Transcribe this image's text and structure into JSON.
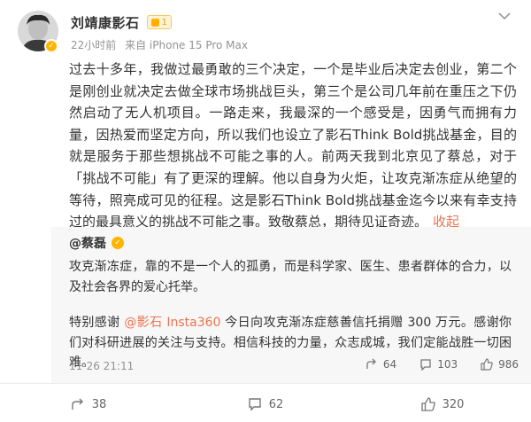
{
  "author": {
    "name": "刘靖康影石",
    "level_badge": "1"
  },
  "meta": {
    "time": "22小时前",
    "source": "来自 iPhone 15 Pro Max"
  },
  "content": {
    "text": "过去十多年，我做过最勇敢的三个决定，一个是毕业后决定去创业，第二个是刚创业就决定去做全球市场挑战巨头，第三个是公司几年前在重压之下仍然启动了无人机项目。一路走来，我最深的一个感受是，因勇气而拥有力量，因热爱而坚定方向，所以我们也设立了影石Think Bold挑战基金，目的就是服务于那些想挑战不可能之事的人。前两天我到北京见了蔡总，对于「挑战不可能」有了更深的理解。他以自身为火炬，让攻克渐冻症从绝望的等待，照亮成可见的征程。这是影石Think Bold挑战基金迄今以来有幸支持过的最具意义的挑战不可能之事。致敬蔡总，期待见证奇迹。",
    "collapse_label": "收起"
  },
  "repost": {
    "author": "@蔡磊",
    "paragraph1": "攻克渐冻症，靠的不是一个人的孤勇，而是科学家、医生、患者群体的合力，以及社会各界的爱心托举。",
    "p2_prefix": "特别感谢 ",
    "mention": "@影石 Insta360",
    "p2_rest": " 今日向攻克渐冻症慈善信托捐赠 300 万元。感谢你们对科研进展的关注与支持。相信科技的力量，众志成城，我们定能战胜一切困难。",
    "time": "11-26 21:11",
    "shares": "64",
    "comments": "103",
    "likes": "986"
  },
  "footer": {
    "shares": "38",
    "comments": "62",
    "likes": "320"
  },
  "colors": {
    "link": "#eb7350",
    "badge": "#ffb500",
    "muted": "#939393"
  }
}
